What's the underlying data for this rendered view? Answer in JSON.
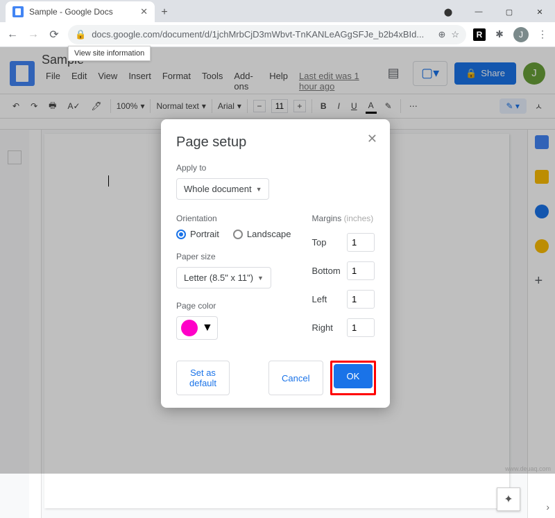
{
  "browser": {
    "tab_title": "Sample - Google Docs",
    "url": "docs.google.com/document/d/1jchMrbCjD3mWbvt-TnKANLeAGgSFJe_b2b4xBId...",
    "tooltip": "View site information",
    "avatar_letter": "J"
  },
  "docs": {
    "title": "Sample",
    "menus": [
      "File",
      "Edit",
      "View",
      "Insert",
      "Format",
      "Tools",
      "Add-ons",
      "Help"
    ],
    "last_edit": "Last edit was 1 hour ago",
    "share": "Share",
    "avatar_letter": "J"
  },
  "toolbar": {
    "zoom": "100%",
    "style": "Normal text",
    "font": "Arial",
    "font_size": "11"
  },
  "dialog": {
    "title": "Page setup",
    "apply_to_label": "Apply to",
    "apply_to_value": "Whole document",
    "orientation_label": "Orientation",
    "orientation_portrait": "Portrait",
    "orientation_landscape": "Landscape",
    "orientation_selected": "portrait",
    "paper_size_label": "Paper size",
    "paper_size_value": "Letter (8.5\" x 11\")",
    "page_color_label": "Page color",
    "page_color_value": "#ff00c8",
    "margins_label": "Margins",
    "margins_unit": "(inches)",
    "margins": {
      "top_label": "Top",
      "top": "1",
      "bottom_label": "Bottom",
      "bottom": "1",
      "left_label": "Left",
      "left": "1",
      "right_label": "Right",
      "right": "1"
    },
    "set_default": "Set as default",
    "cancel": "Cancel",
    "ok": "OK"
  },
  "watermark": "www.deuaq.com"
}
